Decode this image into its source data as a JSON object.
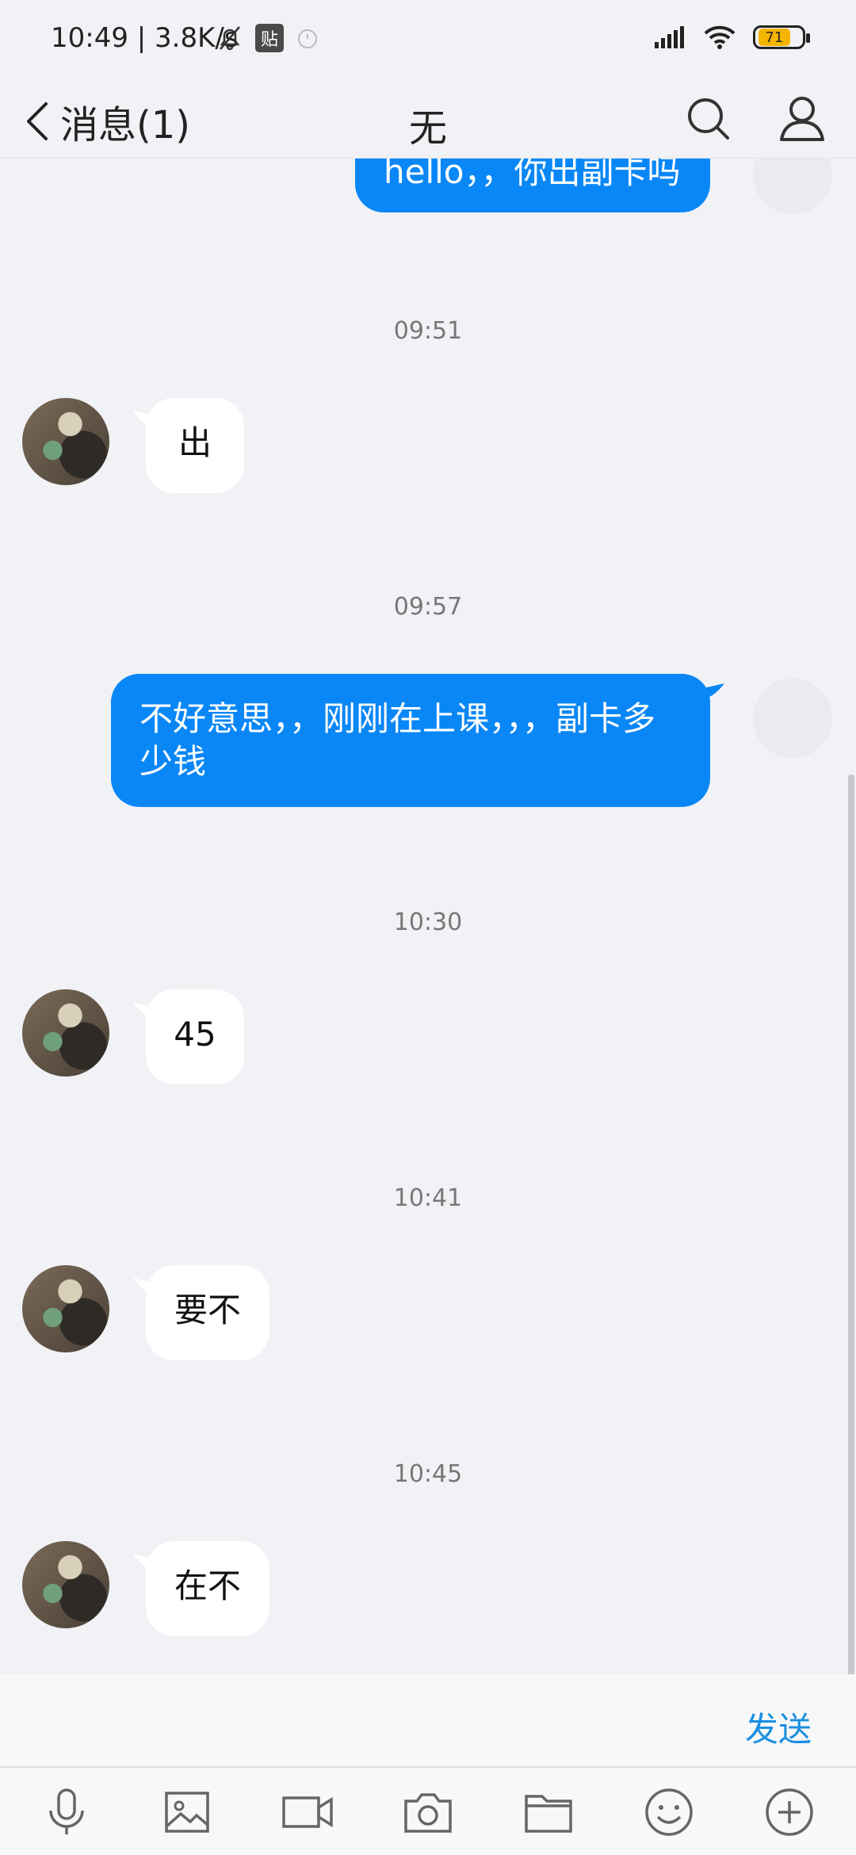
{
  "status_bar": {
    "time_speed": "10:49 | 3.8K/s",
    "tie_label": "贴",
    "battery": "71"
  },
  "nav": {
    "back_label": "消息(1)",
    "title": "无"
  },
  "messages": [
    {
      "type": "out",
      "text": "hello，，你出副卡吗"
    },
    {
      "type": "time",
      "text": "09:51"
    },
    {
      "type": "in",
      "text": "出"
    },
    {
      "type": "time",
      "text": "09:57"
    },
    {
      "type": "out",
      "text": "不好意思，，刚刚在上课，，，副卡多少钱"
    },
    {
      "type": "time",
      "text": "10:30"
    },
    {
      "type": "in",
      "text": "45"
    },
    {
      "type": "time",
      "text": "10:41"
    },
    {
      "type": "in",
      "text": "要不"
    },
    {
      "type": "time",
      "text": "10:45"
    },
    {
      "type": "in",
      "text": "在不"
    }
  ],
  "input": {
    "send_label": "发送"
  },
  "toolbar": {
    "items": [
      "mic-icon",
      "image-icon",
      "video-icon",
      "camera-icon",
      "folder-icon",
      "emoji-icon",
      "plus-icon"
    ]
  },
  "colors": {
    "accent": "#0a87f6",
    "background": "#f1f2f5"
  }
}
